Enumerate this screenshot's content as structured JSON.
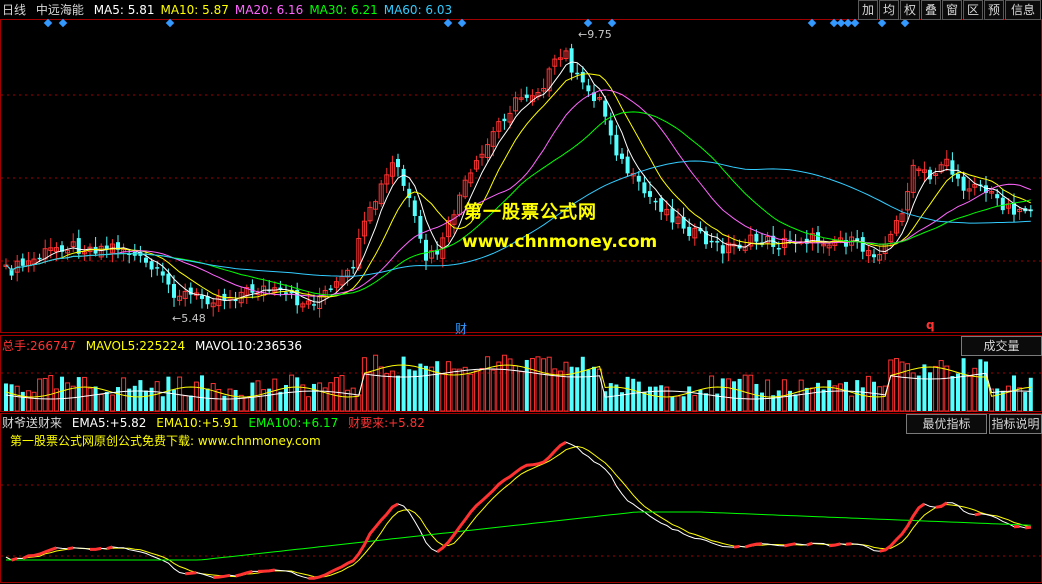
{
  "header": {
    "period": "日线",
    "stock_name": "中远海能",
    "ma": [
      {
        "label": "MA5:",
        "value": "5.81",
        "color": "#ffffff"
      },
      {
        "label": "MA10:",
        "value": "5.87",
        "color": "#ffff00"
      },
      {
        "label": "MA20:",
        "value": "6.16",
        "color": "#ff66ff"
      },
      {
        "label": "MA30:",
        "value": "6.21",
        "color": "#00ff00"
      },
      {
        "label": "MA60:",
        "value": "6.03",
        "color": "#33ccff"
      }
    ],
    "toolbar": [
      "加",
      "均",
      "权",
      "叠",
      "窗",
      "区",
      "预",
      "信息"
    ]
  },
  "price_panel": {
    "high_label": "9.75",
    "low_label": "5.48",
    "marker_cai": "财",
    "marker_q": "q",
    "watermark_title": "第一股票公式网",
    "watermark_url": "www.chnmoney.com"
  },
  "volume_panel": {
    "total_label": "总手:",
    "total_value": "266747",
    "mavol5_label": "MAVOL5:",
    "mavol5_value": "225224",
    "mavol10_label": "MAVOL10:",
    "mavol10_value": "236536",
    "button": "成交量"
  },
  "indicator_panel": {
    "name": "财爷送财来",
    "ema5_label": "EMA5:",
    "ema5_value": "+5.82",
    "ema10_label": "EMA10:",
    "ema10_value": "+5.91",
    "ema100_label": "EMA100:",
    "ema100_value": "+6.17",
    "cai_label": "财要来:",
    "cai_value": "+5.82",
    "subtitle": "第一股票公式网原创公式免费下载: www.chnmoney.com",
    "button_best": "最优指标",
    "button_help": "指标说明"
  },
  "colors": {
    "up": "#ff3232",
    "down": "#54ffff",
    "ma5": "#ffffff",
    "ma10": "#ffff00",
    "ma20": "#ff66ff",
    "ma30": "#00ff00",
    "ma60": "#33ccff",
    "border": "#a00000",
    "signal": "#3399ff"
  }
}
